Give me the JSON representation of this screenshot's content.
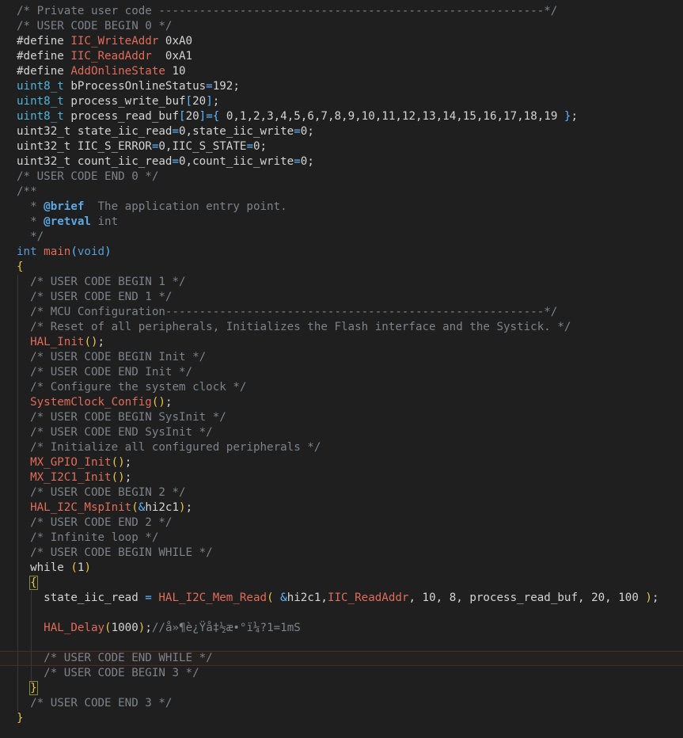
{
  "lines": [
    [
      [
        "c-comment",
        "/* Private user code ---------------------------------------------------------*/"
      ]
    ],
    [
      [
        "c-comment",
        "/* USER CODE BEGIN 0 */"
      ]
    ],
    [
      [
        "c-text",
        "#define "
      ],
      [
        "c-macro",
        "IIC_WriteAddr"
      ],
      [
        "c-text",
        " 0xA0"
      ]
    ],
    [
      [
        "c-text",
        "#define "
      ],
      [
        "c-macro",
        "IIC_ReadAddr"
      ],
      [
        "c-text",
        "  0xA1"
      ]
    ],
    [
      [
        "c-text",
        "#define "
      ],
      [
        "c-macro",
        "AddOnlineState"
      ],
      [
        "c-text",
        " 10"
      ]
    ],
    [
      [
        "c-type",
        "uint8_t"
      ],
      [
        "c-text",
        " bProcessOnlineStatus"
      ],
      [
        "c-op",
        "="
      ],
      [
        "c-text",
        "192;"
      ]
    ],
    [
      [
        "c-type",
        "uint8_t"
      ],
      [
        "c-text",
        " process_write_buf"
      ],
      [
        "c-op",
        "["
      ],
      [
        "c-text",
        "20"
      ],
      [
        "c-op",
        "]"
      ],
      [
        "c-text",
        ";"
      ]
    ],
    [
      [
        "c-type",
        "uint8_t"
      ],
      [
        "c-text",
        " process_read_buf"
      ],
      [
        "c-op",
        "["
      ],
      [
        "c-text",
        "20"
      ],
      [
        "c-op",
        "]="
      ],
      [
        "c-op",
        "{"
      ],
      [
        "c-text",
        " 0,1,2,3,4,5,6,7,8,9,10,11,12,13,14,15,16,17,18,19 "
      ],
      [
        "c-op",
        "}"
      ],
      [
        "c-text",
        ";"
      ]
    ],
    [
      [
        "c-text",
        "uint32_t state_iic_read"
      ],
      [
        "c-op",
        "="
      ],
      [
        "c-text",
        "0,state_iic_write"
      ],
      [
        "c-op",
        "="
      ],
      [
        "c-text",
        "0;"
      ]
    ],
    [
      [
        "c-text",
        "uint32_t IIC_S_ERROR"
      ],
      [
        "c-op",
        "="
      ],
      [
        "c-text",
        "0,IIC_S_STATE"
      ],
      [
        "c-op",
        "="
      ],
      [
        "c-text",
        "0;"
      ]
    ],
    [
      [
        "c-text",
        "uint32_t count_iic_read"
      ],
      [
        "c-op",
        "="
      ],
      [
        "c-text",
        "0,count_iic_write"
      ],
      [
        "c-op",
        "="
      ],
      [
        "c-text",
        "0;"
      ]
    ],
    [
      [
        "c-comment",
        "/* USER CODE END 0 */"
      ]
    ],
    [
      [
        "c-comment",
        "/**"
      ]
    ],
    [
      [
        "c-comment",
        "  * "
      ],
      [
        "c-tag",
        "@brief"
      ],
      [
        "c-comment",
        "  The application entry point."
      ]
    ],
    [
      [
        "c-comment",
        "  * "
      ],
      [
        "c-tag",
        "@retval"
      ],
      [
        "c-ret",
        " int"
      ]
    ],
    [
      [
        "c-comment",
        "  */"
      ]
    ],
    [
      [
        "c-kw",
        "int"
      ],
      [
        "c-text",
        " "
      ],
      [
        "c-macro",
        "main"
      ],
      [
        "c-op",
        "("
      ],
      [
        "c-kw",
        "void"
      ],
      [
        "c-op",
        ")"
      ]
    ],
    [
      [
        "c-paren",
        "{"
      ]
    ],
    [
      [
        "c-comment",
        "  /* USER CODE BEGIN 1 */"
      ]
    ],
    [
      [
        "c-comment",
        "  /* USER CODE END 1 */"
      ]
    ],
    [
      [
        "c-comment",
        "  /* MCU Configuration--------------------------------------------------------*/"
      ]
    ],
    [
      [
        "c-comment",
        "  /* Reset of all peripherals, Initializes the Flash interface and the Systick. */"
      ]
    ],
    [
      [
        "c-text",
        "  "
      ],
      [
        "c-macro",
        "HAL_Init"
      ],
      [
        "c-paren",
        "()"
      ],
      [
        "c-text",
        ";"
      ]
    ],
    [
      [
        "c-comment",
        "  /* USER CODE BEGIN Init */"
      ]
    ],
    [
      [
        "c-comment",
        "  /* USER CODE END Init */"
      ]
    ],
    [
      [
        "c-comment",
        "  /* Configure the system clock */"
      ]
    ],
    [
      [
        "c-text",
        "  "
      ],
      [
        "c-macro",
        "SystemClock_Config"
      ],
      [
        "c-paren",
        "()"
      ],
      [
        "c-text",
        ";"
      ]
    ],
    [
      [
        "c-comment",
        "  /* USER CODE BEGIN SysInit */"
      ]
    ],
    [
      [
        "c-comment",
        "  /* USER CODE END SysInit */"
      ]
    ],
    [
      [
        "c-comment",
        "  /* Initialize all configured peripherals */"
      ]
    ],
    [
      [
        "c-text",
        "  "
      ],
      [
        "c-macro",
        "MX_GPIO_Init"
      ],
      [
        "c-paren",
        "()"
      ],
      [
        "c-text",
        ";"
      ]
    ],
    [
      [
        "c-text",
        "  "
      ],
      [
        "c-macro",
        "MX_I2C1_Init"
      ],
      [
        "c-paren",
        "()"
      ],
      [
        "c-text",
        ";"
      ]
    ],
    [
      [
        "c-comment",
        "  /* USER CODE BEGIN 2 */"
      ]
    ],
    [
      [
        "c-text",
        "  "
      ],
      [
        "c-macro",
        "HAL_I2C_MspInit"
      ],
      [
        "c-paren",
        "("
      ],
      [
        "c-op",
        "&"
      ],
      [
        "c-text",
        "hi2c1"
      ],
      [
        "c-paren",
        ")"
      ],
      [
        "c-text",
        ";"
      ]
    ],
    [
      [
        "c-comment",
        "  /* USER CODE END 2 */"
      ]
    ],
    [
      [
        "c-comment",
        "  /* Infinite loop */"
      ]
    ],
    [
      [
        "c-comment",
        "  /* USER CODE BEGIN WHILE */"
      ]
    ],
    [
      [
        "c-text",
        "  while "
      ],
      [
        "c-paren",
        "("
      ],
      [
        "c-text",
        "1"
      ],
      [
        "c-paren",
        ")"
      ]
    ],
    [
      [
        "c-text",
        "  "
      ],
      [
        "c-paren",
        "{"
      ]
    ],
    [
      [
        "c-text",
        "    state_iic_read "
      ],
      [
        "c-op",
        "="
      ],
      [
        "c-text",
        " "
      ],
      [
        "c-macro",
        "HAL_I2C_Mem_Read"
      ],
      [
        "c-paren",
        "("
      ],
      [
        "c-text",
        " "
      ],
      [
        "c-op",
        "&"
      ],
      [
        "c-text",
        "hi2c1,"
      ],
      [
        "c-macro",
        "IIC_ReadAddr"
      ],
      [
        "c-text",
        ", 10, 8, process_read_buf, 20, 100 "
      ],
      [
        "c-paren",
        ")"
      ],
      [
        "c-text",
        ";"
      ]
    ],
    [
      [
        "c-text",
        ""
      ]
    ],
    [
      [
        "c-text",
        "    "
      ],
      [
        "c-macro",
        "HAL_Delay"
      ],
      [
        "c-paren",
        "("
      ],
      [
        "c-text",
        "1000"
      ],
      [
        "c-paren",
        ")"
      ],
      [
        "c-text",
        ";"
      ],
      [
        "c-comment",
        "//å»¶è¿Ÿå‡½æ•°ï¼?1=1mS"
      ]
    ],
    [
      [
        "c-text",
        ""
      ]
    ],
    [
      [
        "c-comment",
        "    /* USER CODE END WHILE */"
      ]
    ],
    [
      [
        "c-comment",
        "    /* USER CODE BEGIN 3 */"
      ]
    ],
    [
      [
        "c-text",
        "  "
      ],
      [
        "c-paren",
        "}"
      ]
    ],
    [
      [
        "c-comment",
        "  /* USER CODE END 3 */"
      ]
    ],
    [
      [
        "c-paren",
        "}"
      ]
    ]
  ],
  "current_line": 43
}
